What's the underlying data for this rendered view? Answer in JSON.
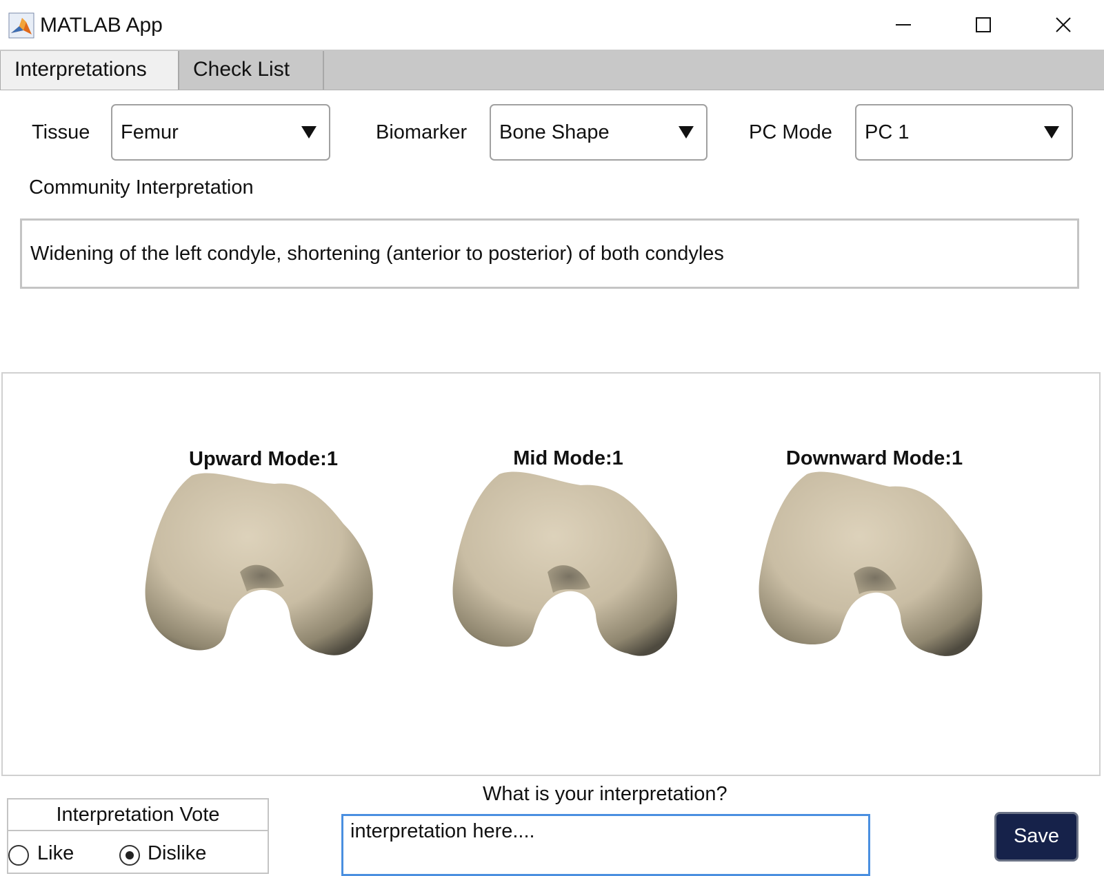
{
  "window": {
    "title": "MATLAB App",
    "icon": "matlab-logo-icon"
  },
  "tabs": [
    {
      "label": "Interpretations",
      "selected": true
    },
    {
      "label": "Check List",
      "selected": false
    }
  ],
  "controls": {
    "tissue_label": "Tissue",
    "tissue_value": "Femur",
    "biomarker_label": "Biomarker",
    "biomarker_value": "Bone Shape",
    "pcmode_label": "PC Mode",
    "pcmode_value": "PC 1"
  },
  "community": {
    "label": "Community Interpretation",
    "text": "Widening of the left condyle, shortening (anterior to posterior) of both condyles"
  },
  "figure": {
    "panels": [
      {
        "title": "Upward Mode:1"
      },
      {
        "title": "Mid Mode:1"
      },
      {
        "title": "Downward Mode:1"
      }
    ],
    "bone_color": "#d8ccb4"
  },
  "vote": {
    "title": "Interpretation Vote",
    "like_label": "Like",
    "dislike_label": "Dislike",
    "selected": "Dislike"
  },
  "input": {
    "question": "What is your interpretation?",
    "value": "interpretation here...."
  },
  "save": {
    "label": "Save"
  },
  "colors": {
    "accent_focus": "#4a8fe0",
    "save_bg": "#16224a",
    "tab_bar": "#c8c8c8"
  }
}
